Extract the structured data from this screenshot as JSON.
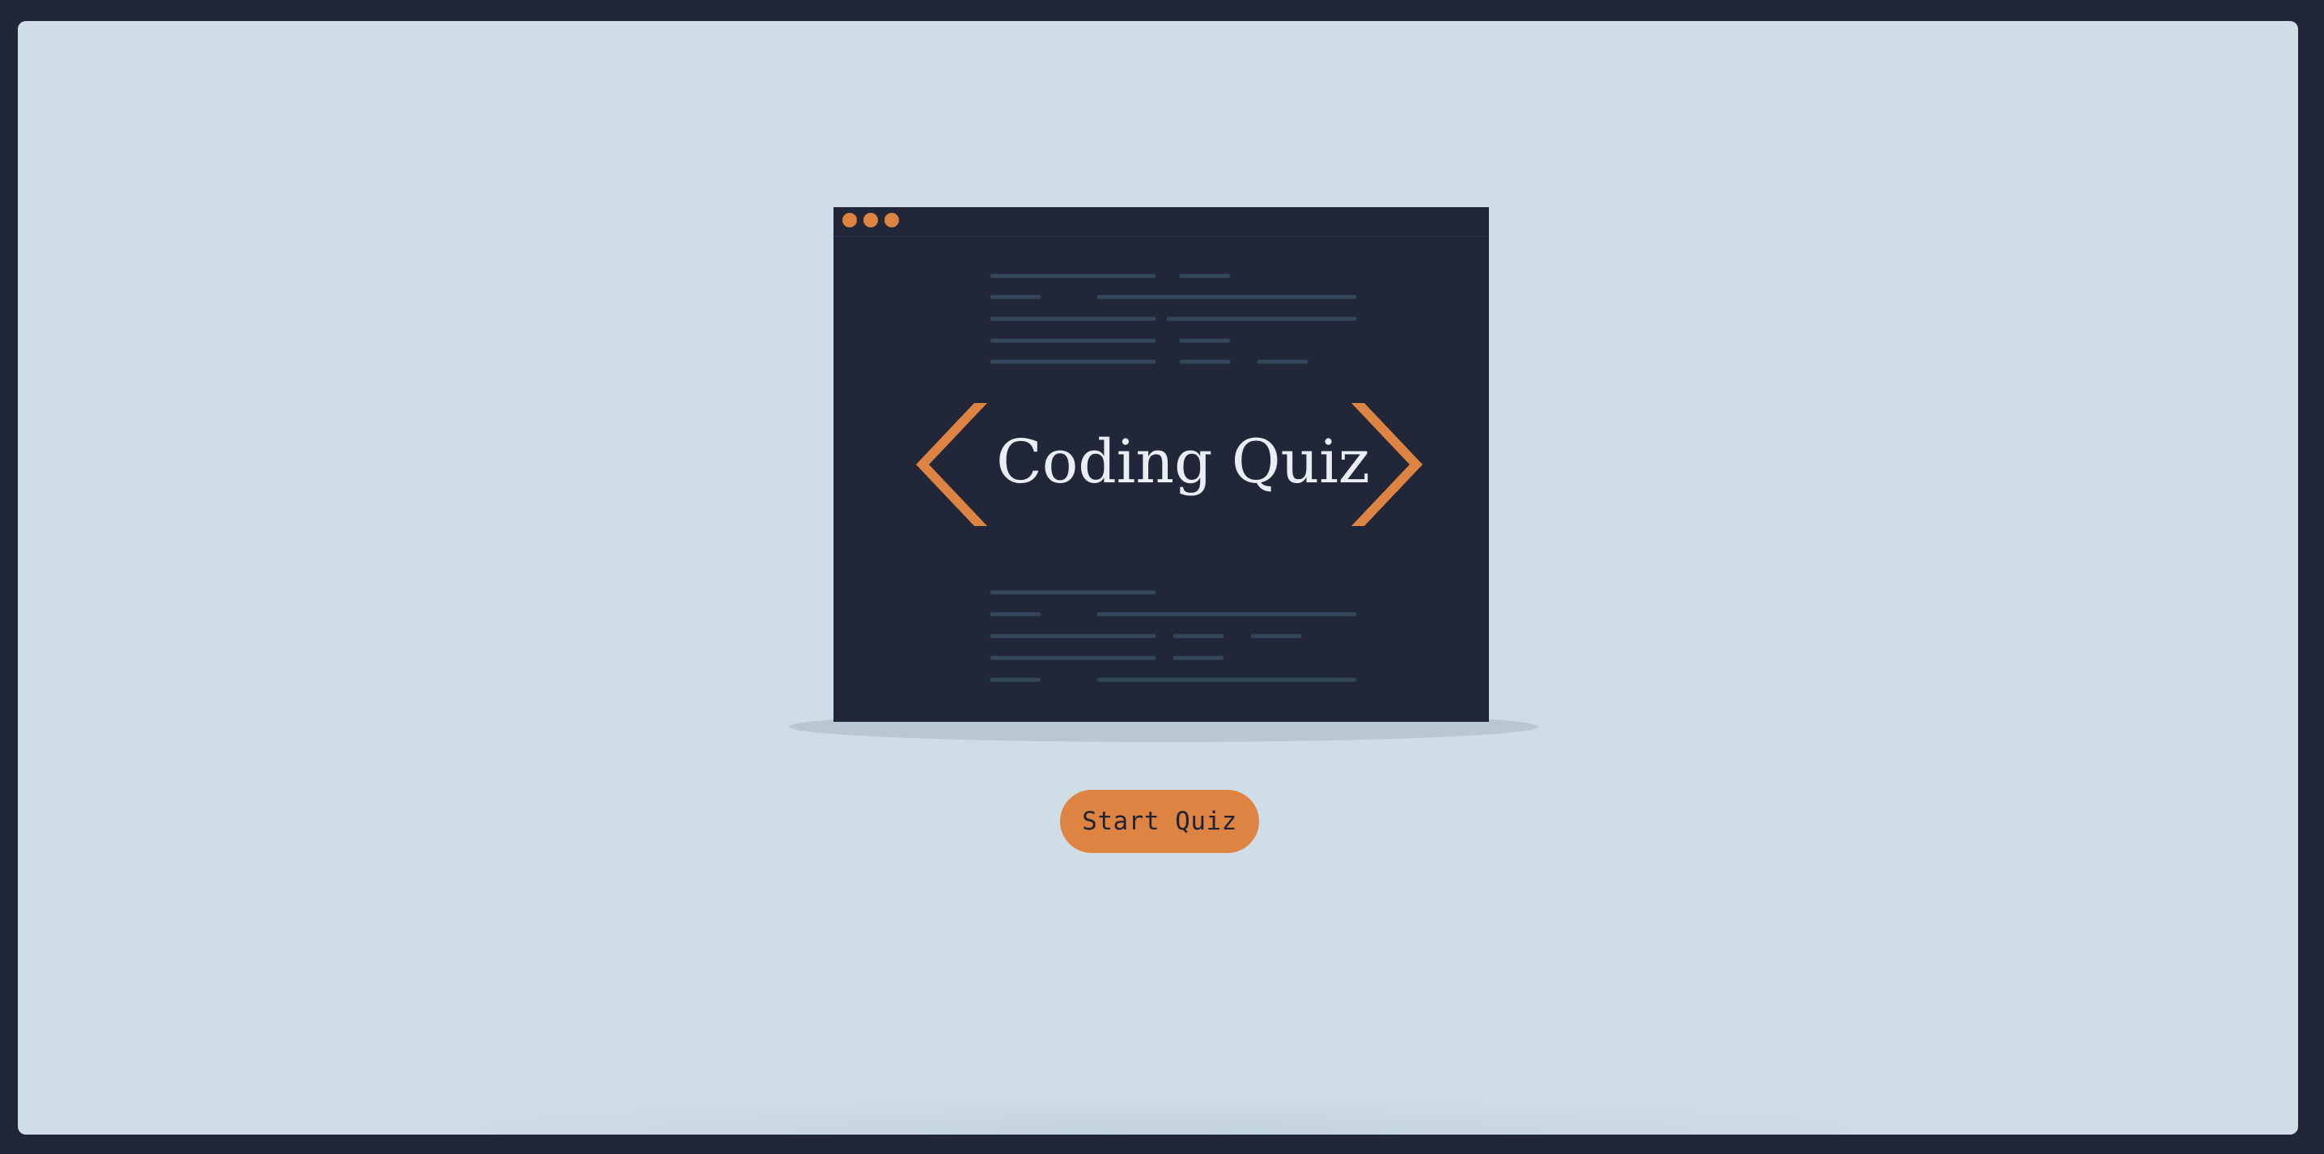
{
  "app": {
    "illustration": {
      "title": "Coding Quiz",
      "window_dots": 3,
      "icons": [
        "code-left-chevron-icon",
        "code-right-chevron-icon"
      ]
    },
    "actions": {
      "start_label": "Start Quiz"
    },
    "colors": {
      "page_border": "#212739",
      "background": "#cfdde6",
      "window": "#212739",
      "accent": "#dd8443",
      "title_text": "#e8eef3",
      "code_lines": "#34465a",
      "shadow": "#b8c7d1"
    }
  }
}
